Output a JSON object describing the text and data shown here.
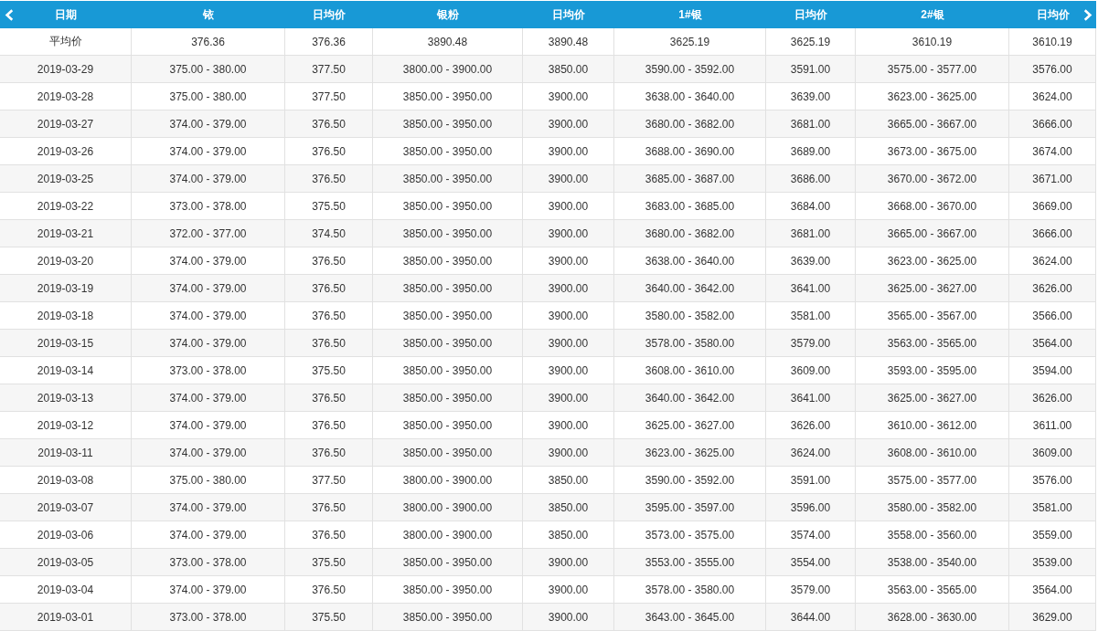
{
  "table": {
    "columns": [
      "日期",
      "铱",
      "日均价",
      "银粉",
      "日均价",
      "1#银",
      "日均价",
      "2#银",
      "日均价"
    ],
    "rows": [
      [
        "平均价",
        "376.36",
        "376.36",
        "3890.48",
        "3890.48",
        "3625.19",
        "3625.19",
        "3610.19",
        "3610.19"
      ],
      [
        "2019-03-29",
        "375.00 - 380.00",
        "377.50",
        "3800.00 - 3900.00",
        "3850.00",
        "3590.00 - 3592.00",
        "3591.00",
        "3575.00 - 3577.00",
        "3576.00"
      ],
      [
        "2019-03-28",
        "375.00 - 380.00",
        "377.50",
        "3850.00 - 3950.00",
        "3900.00",
        "3638.00 - 3640.00",
        "3639.00",
        "3623.00 - 3625.00",
        "3624.00"
      ],
      [
        "2019-03-27",
        "374.00 - 379.00",
        "376.50",
        "3850.00 - 3950.00",
        "3900.00",
        "3680.00 - 3682.00",
        "3681.00",
        "3665.00 - 3667.00",
        "3666.00"
      ],
      [
        "2019-03-26",
        "374.00 - 379.00",
        "376.50",
        "3850.00 - 3950.00",
        "3900.00",
        "3688.00 - 3690.00",
        "3689.00",
        "3673.00 - 3675.00",
        "3674.00"
      ],
      [
        "2019-03-25",
        "374.00 - 379.00",
        "376.50",
        "3850.00 - 3950.00",
        "3900.00",
        "3685.00 - 3687.00",
        "3686.00",
        "3670.00 - 3672.00",
        "3671.00"
      ],
      [
        "2019-03-22",
        "373.00 - 378.00",
        "375.50",
        "3850.00 - 3950.00",
        "3900.00",
        "3683.00 - 3685.00",
        "3684.00",
        "3668.00 - 3670.00",
        "3669.00"
      ],
      [
        "2019-03-21",
        "372.00 - 377.00",
        "374.50",
        "3850.00 - 3950.00",
        "3900.00",
        "3680.00 - 3682.00",
        "3681.00",
        "3665.00 - 3667.00",
        "3666.00"
      ],
      [
        "2019-03-20",
        "374.00 - 379.00",
        "376.50",
        "3850.00 - 3950.00",
        "3900.00",
        "3638.00 - 3640.00",
        "3639.00",
        "3623.00 - 3625.00",
        "3624.00"
      ],
      [
        "2019-03-19",
        "374.00 - 379.00",
        "376.50",
        "3850.00 - 3950.00",
        "3900.00",
        "3640.00 - 3642.00",
        "3641.00",
        "3625.00 - 3627.00",
        "3626.00"
      ],
      [
        "2019-03-18",
        "374.00 - 379.00",
        "376.50",
        "3850.00 - 3950.00",
        "3900.00",
        "3580.00 - 3582.00",
        "3581.00",
        "3565.00 - 3567.00",
        "3566.00"
      ],
      [
        "2019-03-15",
        "374.00 - 379.00",
        "376.50",
        "3850.00 - 3950.00",
        "3900.00",
        "3578.00 - 3580.00",
        "3579.00",
        "3563.00 - 3565.00",
        "3564.00"
      ],
      [
        "2019-03-14",
        "373.00 - 378.00",
        "375.50",
        "3850.00 - 3950.00",
        "3900.00",
        "3608.00 - 3610.00",
        "3609.00",
        "3593.00 - 3595.00",
        "3594.00"
      ],
      [
        "2019-03-13",
        "374.00 - 379.00",
        "376.50",
        "3850.00 - 3950.00",
        "3900.00",
        "3640.00 - 3642.00",
        "3641.00",
        "3625.00 - 3627.00",
        "3626.00"
      ],
      [
        "2019-03-12",
        "374.00 - 379.00",
        "376.50",
        "3850.00 - 3950.00",
        "3900.00",
        "3625.00 - 3627.00",
        "3626.00",
        "3610.00 - 3612.00",
        "3611.00"
      ],
      [
        "2019-03-11",
        "374.00 - 379.00",
        "376.50",
        "3850.00 - 3950.00",
        "3900.00",
        "3623.00 - 3625.00",
        "3624.00",
        "3608.00 - 3610.00",
        "3609.00"
      ],
      [
        "2019-03-08",
        "375.00 - 380.00",
        "377.50",
        "3800.00 - 3900.00",
        "3850.00",
        "3590.00 - 3592.00",
        "3591.00",
        "3575.00 - 3577.00",
        "3576.00"
      ],
      [
        "2019-03-07",
        "374.00 - 379.00",
        "376.50",
        "3800.00 - 3900.00",
        "3850.00",
        "3595.00 - 3597.00",
        "3596.00",
        "3580.00 - 3582.00",
        "3581.00"
      ],
      [
        "2019-03-06",
        "374.00 - 379.00",
        "376.50",
        "3800.00 - 3900.00",
        "3850.00",
        "3573.00 - 3575.00",
        "3574.00",
        "3558.00 - 3560.00",
        "3559.00"
      ],
      [
        "2019-03-05",
        "373.00 - 378.00",
        "375.50",
        "3850.00 - 3950.00",
        "3900.00",
        "3553.00 - 3555.00",
        "3554.00",
        "3538.00 - 3540.00",
        "3539.00"
      ],
      [
        "2019-03-04",
        "374.00 - 379.00",
        "376.50",
        "3850.00 - 3950.00",
        "3900.00",
        "3578.00 - 3580.00",
        "3579.00",
        "3563.00 - 3565.00",
        "3564.00"
      ],
      [
        "2019-03-01",
        "373.00 - 378.00",
        "375.50",
        "3850.00 - 3950.00",
        "3900.00",
        "3643.00 - 3645.00",
        "3644.00",
        "3628.00 - 3630.00",
        "3629.00"
      ]
    ]
  }
}
